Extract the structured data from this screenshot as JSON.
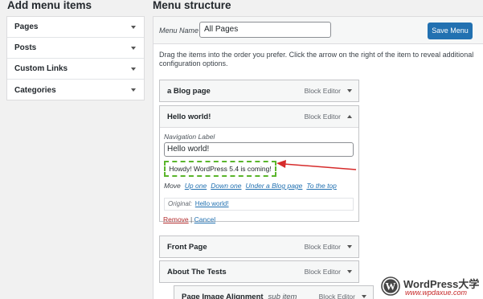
{
  "left": {
    "heading": "Add menu items",
    "items": [
      {
        "label": "Pages"
      },
      {
        "label": "Posts"
      },
      {
        "label": "Custom Links"
      },
      {
        "label": "Categories"
      }
    ]
  },
  "right": {
    "heading": "Menu structure",
    "menu_name_label": "Menu Name",
    "menu_name_value": "All Pages",
    "save_label": "Save Menu",
    "instructions": "Drag the items into the order you prefer. Click the arrow on the right of the item to reveal additional configuration options."
  },
  "menu_items": [
    {
      "title": "a Blog page",
      "type": "Block Editor"
    },
    {
      "title": "Hello world!",
      "type": "Block Editor"
    },
    {
      "title": "Front Page",
      "type": "Block Editor"
    },
    {
      "title": "About The Tests",
      "type": "Block Editor"
    },
    {
      "title": "Page Image Alignment",
      "sub": "sub item",
      "type": "Block Editor"
    }
  ],
  "expanded": {
    "nav_label_caption": "Navigation Label",
    "nav_label_value": "Hello world!",
    "notice": "Howdy! WordPress 5.4 is coming!",
    "move_label": "Move",
    "move_links": [
      "Up one",
      "Down one",
      "Under a Blog page",
      "To the top"
    ],
    "original_label": "Original:",
    "original_link": "Hello world!",
    "remove_label": "Remove",
    "separator": "|",
    "cancel_label": "Cancel"
  },
  "watermark": {
    "brand": "WordPress大学",
    "url": "www.wpdaxue.com"
  },
  "colors": {
    "accent": "#2271b1",
    "arrow": "#d62b2b",
    "highlight_border": "#5ab52b",
    "remove": "#b32d2e"
  }
}
